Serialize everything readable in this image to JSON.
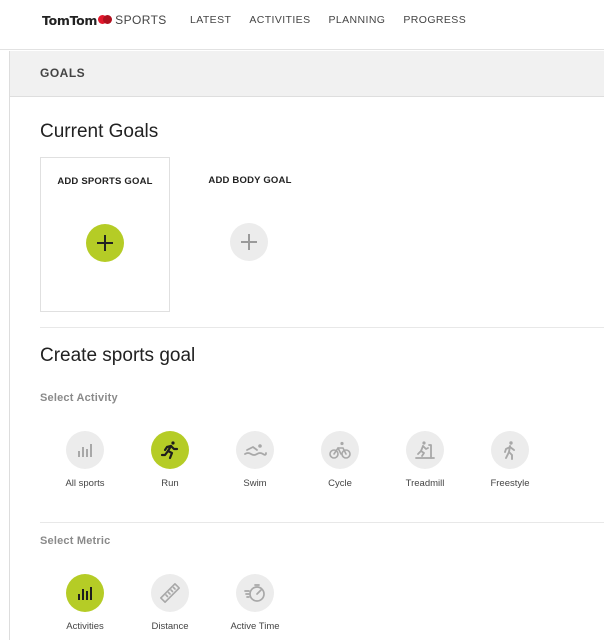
{
  "brand": {
    "wordmark": "TomTom",
    "product": "SPORTS",
    "logo_color": "#e2182c"
  },
  "nav": {
    "items": [
      {
        "label": "LATEST"
      },
      {
        "label": "ACTIVITIES"
      },
      {
        "label": "PLANNING"
      },
      {
        "label": "PROGRESS"
      }
    ]
  },
  "page": {
    "section_header": "GOALS"
  },
  "current_goals": {
    "title": "Current Goals",
    "cards": [
      {
        "label": "ADD SPORTS GOAL",
        "icon": "plus-icon",
        "active": true
      },
      {
        "label": "ADD BODY GOAL",
        "icon": "plus-icon",
        "active": false
      }
    ]
  },
  "create": {
    "title": "Create sports goal",
    "activity_label": "Select Activity",
    "activities": [
      {
        "label": "All sports",
        "icon": "bar-chart-icon",
        "selected": false
      },
      {
        "label": "Run",
        "icon": "runner-icon",
        "selected": true
      },
      {
        "label": "Swim",
        "icon": "swimmer-icon",
        "selected": false
      },
      {
        "label": "Cycle",
        "icon": "cyclist-icon",
        "selected": false
      },
      {
        "label": "Treadmill",
        "icon": "treadmill-icon",
        "selected": false
      },
      {
        "label": "Freestyle",
        "icon": "freestyle-icon",
        "selected": false
      }
    ],
    "metric_label": "Select Metric",
    "metrics": [
      {
        "label": "Activities",
        "icon": "bar-chart-icon",
        "selected": true
      },
      {
        "label": "Distance",
        "icon": "ruler-icon",
        "selected": false
      },
      {
        "label": "Active Time",
        "icon": "stopwatch-icon",
        "selected": false
      }
    ]
  },
  "colors": {
    "accent": "#b5cc26",
    "inactive_circle": "#ececec",
    "band": "#f1f1f1"
  }
}
